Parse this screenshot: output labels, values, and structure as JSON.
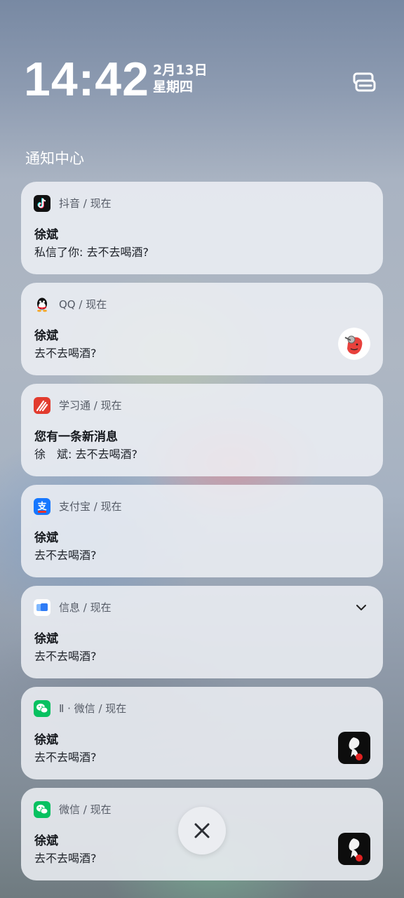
{
  "status": {
    "time": "14:42",
    "date": "2月13日",
    "weekday": "星期四"
  },
  "section_title": "通知中心",
  "notifications": [
    {
      "app": "抖音",
      "when": "现在",
      "title": "徐斌",
      "body": "私信了你: 去不去喝酒?",
      "icon": "douyin-icon"
    },
    {
      "app": "QQ",
      "when": "现在",
      "title": "徐斌",
      "body": "去不去喝酒?",
      "icon": "qq-icon"
    },
    {
      "app": "学习通",
      "when": "现在",
      "title": "您有一条新消息",
      "body": "徐　斌: 去不去喝酒?",
      "icon": "xuexitong-icon"
    },
    {
      "app": "支付宝",
      "when": "现在",
      "title": "徐斌",
      "body": "去不去喝酒?",
      "icon": "alipay-icon"
    },
    {
      "app": "信息",
      "when": "现在",
      "title": "徐斌",
      "body": "去不去喝酒?",
      "icon": "messages-icon"
    },
    {
      "app": "Ⅱ · 微信",
      "when": "现在",
      "title": "徐斌",
      "body": "去不去喝酒?",
      "icon": "wechat-icon"
    },
    {
      "app": "微信",
      "when": "现在",
      "title": "徐斌",
      "body": "去不去喝酒?",
      "icon": "wechat-icon"
    }
  ],
  "separator": "/",
  "colors": {
    "text_white": "#ffffff",
    "card_bg": "#eef0f5",
    "douyin": "#111111",
    "alipay": "#1677ff",
    "wechat": "#07c160",
    "xuexitong": "#e23b2e",
    "messages": "#2f7cf6"
  }
}
